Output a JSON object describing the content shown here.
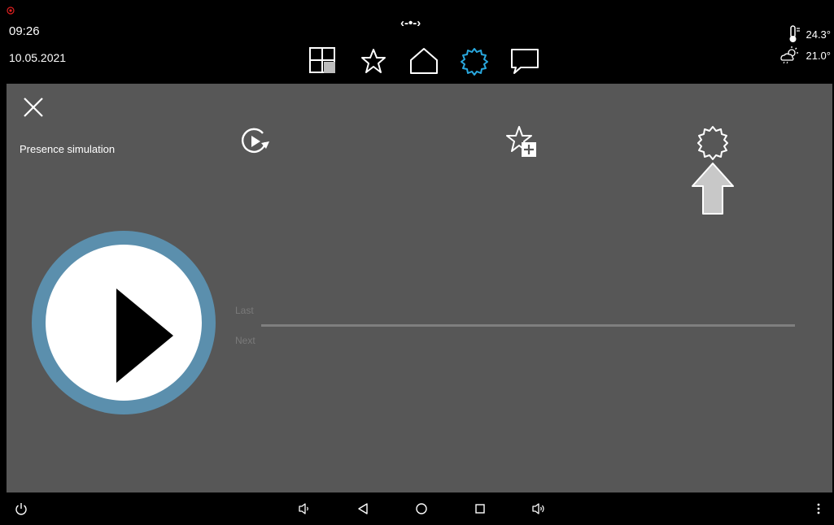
{
  "status": {
    "time": "09:26",
    "date": "10.05.2021",
    "logo": "‹-•-›",
    "indoor_temp": "24.3°",
    "outdoor_temp": "21.0°"
  },
  "nav": {
    "icons": [
      "rooms-icon",
      "favorites-icon",
      "home-icon",
      "settings-icon",
      "messages-icon"
    ],
    "active": "settings-icon",
    "active_color": "#29a9e0"
  },
  "panel": {
    "title": "Presence simulation",
    "last_label": "Last",
    "next_label": "Next",
    "play_ring_color": "#5b8fad"
  },
  "toolbar": {
    "icons": [
      "replay-icon",
      "add-favorite-icon",
      "settings-icon"
    ]
  },
  "android_nav": {
    "icons": [
      "power-icon",
      "volume-down-icon",
      "back-icon",
      "home-icon",
      "recents-icon",
      "volume-up-icon",
      "more-icon"
    ]
  }
}
